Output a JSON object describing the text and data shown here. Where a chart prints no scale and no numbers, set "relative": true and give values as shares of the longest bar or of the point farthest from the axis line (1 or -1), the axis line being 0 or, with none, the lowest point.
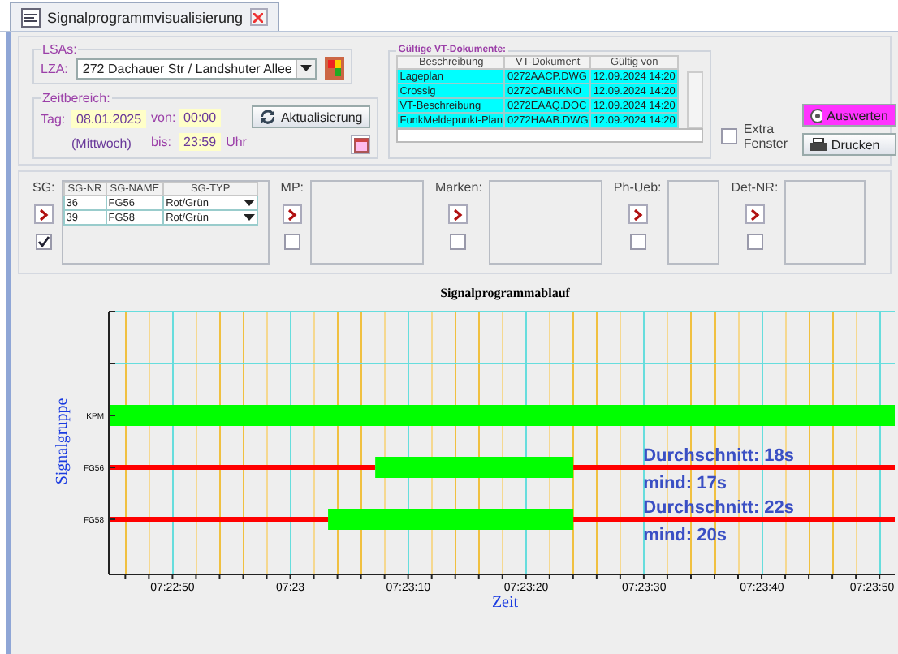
{
  "tab": {
    "title": "Signalprogrammvisualisierung",
    "selected": true
  },
  "lsa": {
    "title": "LSAs:",
    "lza_label": "LZA:",
    "lza_value": "272  Dachauer Str / Landshuter Allee"
  },
  "zeitbereich": {
    "title": "Zeitbereich:",
    "tag_label": "Tag:",
    "date": "08.01.2025",
    "weekday": "(Mittwoch)",
    "von_label": "von:",
    "von": "00:00",
    "bis_label": "bis:",
    "bis": "23:59",
    "uhr": "Uhr"
  },
  "refresh_button": "Aktualisierung",
  "vt_documents": {
    "title": "Gültige VT-Dokumente:",
    "columns": [
      "Beschreibung",
      "VT-Dokument",
      "Gültig von"
    ],
    "rows": [
      [
        "Lageplan",
        "0272AACP.DWG",
        "12.09.2024 14:20"
      ],
      [
        "Crossig",
        "0272CABI.KNO",
        "12.09.2024 14:20"
      ],
      [
        "VT-Beschreibung",
        "0272EAAQ.DOC",
        "12.09.2024 14:20"
      ],
      [
        "FunkMeldepunkt-Plan",
        "0272HAAB.DWG",
        "12.09.2024 14:20"
      ]
    ]
  },
  "extra_window": {
    "label": "Extra Fenster",
    "checked": false
  },
  "evaluate_button": "Auswerten",
  "print_button": "Drucken",
  "filters": [
    {
      "kind": "table",
      "label": "SG:",
      "checked": true,
      "columns": [
        "SG-NR",
        "SG-NAME",
        "SG-TYP"
      ],
      "rows": [
        [
          "36",
          "FG56",
          "Rot/Grün"
        ],
        [
          "39",
          "FG58",
          "Rot/Grün"
        ]
      ]
    },
    {
      "kind": "list",
      "label": "MP:",
      "checked": false
    },
    {
      "kind": "list",
      "label": "Marken:",
      "checked": false
    },
    {
      "kind": "list",
      "label": "Ph-Ueb:",
      "checked": false
    },
    {
      "kind": "list",
      "label": "Det-NR:",
      "checked": false
    }
  ],
  "chart": {
    "chart_data": {
      "type": "bar",
      "orientation": "horizontal",
      "stacked": true,
      "title": "Signalprogrammablauf",
      "xlabel": "Zeit",
      "ylabel": "Signalgruppe",
      "categories": [
        "KPM",
        "FG56",
        "FG58"
      ],
      "series": [
        {
          "color": "#ff0000",
          "values": [
            null,
            0.339,
            0.279
          ]
        },
        {
          "color": "#00ff00",
          "values": [
            1,
            0.252,
            0.312
          ]
        },
        {
          "color": "#ff0000",
          "values": [
            null,
            0.409,
            0.409
          ]
        }
      ],
      "relative": true,
      "annotations": [
        "Durchschnitt: 18s",
        "mind: 17s",
        "Durchschnitt: 22s",
        "mind: 20s"
      ]
    },
    "time_labels": [
      "07:22:50",
      "07:23",
      "07:23:10",
      "07:23:20",
      "07:23:30",
      "07:23:40",
      "07:23:50"
    ]
  }
}
